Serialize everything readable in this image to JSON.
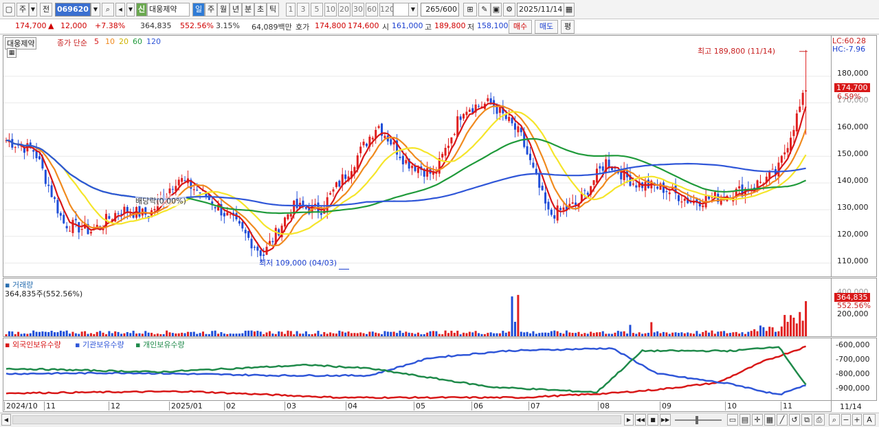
{
  "toolbar": {
    "market_label": "주",
    "prev_label": "전",
    "code_value": "069620",
    "stock_name": "대웅제약",
    "shin_badge": "신",
    "period_buttons": [
      "일",
      "주",
      "월",
      "년",
      "분",
      "초",
      "틱"
    ],
    "interval_buttons": [
      "1",
      "3",
      "5",
      "10",
      "20",
      "30",
      "60",
      "120"
    ],
    "count_value": "265",
    "count_total": "/600",
    "date_value": "2025/11/14"
  },
  "quote": {
    "price": "174,700",
    "change_arrow": "▲",
    "change": "12,000",
    "change_pct": "+7.38%",
    "volume": "364,835",
    "volume_ratio": "552.56%",
    "turnover_pct": "3.15%",
    "amount": "64,089백만",
    "bid_label": "호가",
    "ask_price": "174,800",
    "bid_price": "174,600",
    "open_label": "시",
    "open": "161,000",
    "high_label": "고",
    "high": "189,800",
    "low_label": "저",
    "low": "158,100",
    "buy_button": "매수",
    "sell_button": "매도",
    "eval_button": "평"
  },
  "price_pane": {
    "legend_name": "대웅제약",
    "legend_ma": "종가 단순",
    "ma_periods": [
      "5",
      "10",
      "20",
      "60",
      "120"
    ],
    "ma_colors": [
      "#d81818",
      "#f08a1e",
      "#f5e52a",
      "#1f9a3a",
      "#2f56d8"
    ],
    "high_note": "최고 189,800 (11/14)",
    "low_note": "최저 109,000 (04/03)",
    "dividend_note": "배당락(0.00%)",
    "lc_label": "LC:60.28",
    "hc_label": "HC:-7.96",
    "current_tag": "174,700",
    "current_pct": "6.59%",
    "y_ticks": [
      "180,000",
      "170,000",
      "160,000",
      "150,000",
      "140,000",
      "130,000",
      "120,000",
      "110,000"
    ]
  },
  "volume_pane": {
    "title": "거래량",
    "value": "364,835주(552.56%)",
    "tag": "364,835",
    "tag_pct": "552.56%",
    "y_ticks": [
      "400,000",
      "200,000"
    ]
  },
  "holdings_pane": {
    "legends": [
      "외국인보유수량",
      "기관보유수량",
      "개인보유수량"
    ],
    "colors": [
      "#d81818",
      "#2f56d8",
      "#1f8a4a"
    ],
    "y_ticks": [
      "-600,000",
      "-700,000",
      "-800,000",
      "-900,000"
    ]
  },
  "x_axis": {
    "labels": [
      "2024/10",
      "11",
      "12",
      "2025/01",
      "02",
      "03",
      "04",
      "05",
      "06",
      "07",
      "08",
      "09",
      "10",
      "11"
    ],
    "end_label": "11/14"
  },
  "chart_data": {
    "type": "candlestick",
    "symbol": "069620",
    "name": "대웅제약",
    "period": "daily",
    "months": [
      "2024/10",
      "11",
      "12",
      "2025/01",
      "02",
      "03",
      "04",
      "05",
      "06",
      "07",
      "08",
      "09",
      "10",
      "11"
    ],
    "close_approx": [
      156000,
      152000,
      125000,
      122000,
      130000,
      128000,
      142000,
      135000,
      125000,
      113000,
      131000,
      130000,
      145000,
      162000,
      148000,
      143000,
      168000,
      170000,
      158000,
      128000,
      132000,
      148000,
      140000,
      138000,
      133000,
      135000,
      138000,
      144000,
      174700
    ],
    "high": 189800,
    "high_date": "11/14",
    "low": 109000,
    "low_date": "04/03",
    "last_close": 174700,
    "ylim": [
      105000,
      190000
    ],
    "volume_last": 364835
  }
}
